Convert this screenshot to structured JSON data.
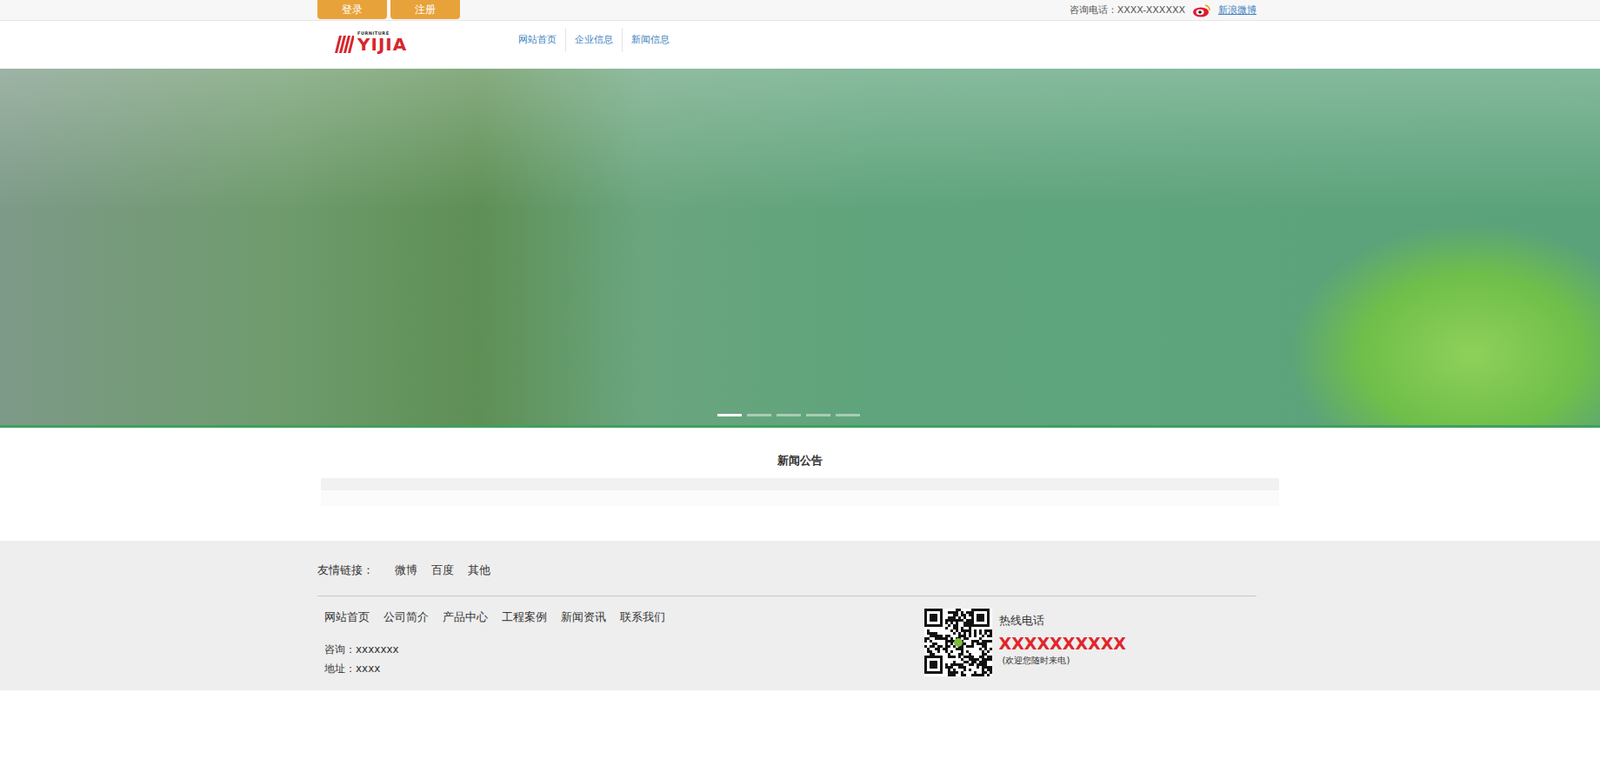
{
  "topbar": {
    "buttons": [
      {
        "label": "登录"
      },
      {
        "label": "注册"
      }
    ],
    "phone": "咨询电话：XXXX-XXXXXX",
    "weibo": "新浪微博"
  },
  "logo": {
    "text": "YIJIA",
    "tagline": "FURNITURE"
  },
  "nav": [
    {
      "label": "网站首页",
      "selected": false
    },
    {
      "label": "企业信息",
      "selected": false
    },
    {
      "label": "新闻信息",
      "selected": false
    }
  ],
  "banner": {
    "indicators": [
      {
        "selected": true
      },
      {
        "selected": false
      },
      {
        "selected": false
      },
      {
        "selected": false
      },
      {
        "selected": false
      }
    ]
  },
  "news": {
    "title": "新闻公告"
  },
  "footer": {
    "links_label": "友情链接：",
    "links": [
      "微博",
      "百度",
      "其他"
    ],
    "menu": [
      "网站首页",
      "公司简介",
      "产品中心",
      "工程案例",
      "新闻资讯",
      "联系我们"
    ],
    "consult": "咨询：xxxxxxx",
    "address": "地址：xxxx",
    "hotline_label": "热线电话",
    "hotline": "XXXXXXXXXX",
    "hotline_note": "(欢迎您随时来电)"
  }
}
